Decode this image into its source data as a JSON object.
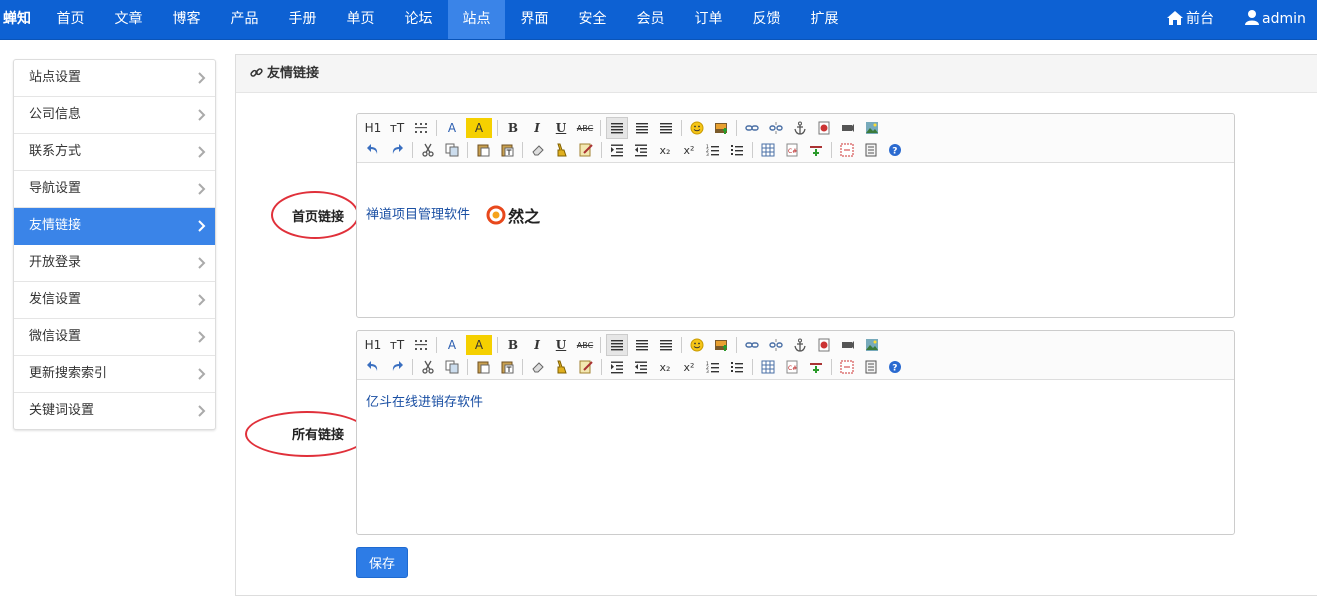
{
  "brand": "蝉知",
  "nav": {
    "items": [
      "首页",
      "文章",
      "博客",
      "产品",
      "手册",
      "单页",
      "论坛",
      "站点",
      "界面",
      "安全",
      "会员",
      "订单",
      "反馈",
      "扩展"
    ],
    "active": "站点",
    "frontend": "前台",
    "user": "admin"
  },
  "sidebar": {
    "items": [
      "站点设置",
      "公司信息",
      "联系方式",
      "导航设置",
      "友情链接",
      "开放登录",
      "发信设置",
      "微信设置",
      "更新搜索索引",
      "关键词设置"
    ],
    "active": "友情链接"
  },
  "panel": {
    "title": "友情链接"
  },
  "form": {
    "home_links_label": "首页链接",
    "all_links_label": "所有链接",
    "home_links_text": "禅道项目管理软件",
    "home_links_logo_text": "然之",
    "all_links_text": "亿斗在线进销存软件",
    "save_label": "保存"
  },
  "toolbar": {
    "heading_label": "H1",
    "fontsize_label": "тT",
    "bold": "B",
    "italic": "I",
    "underline": "U",
    "strike": "ABC",
    "font_color": "A",
    "bg_color": "A",
    "subscript": "x₂",
    "superscript": "x²"
  },
  "colors": {
    "nav_bg": "#0d61d3",
    "nav_active": "#3a84e8",
    "sidebar_active": "#3a84e8",
    "annotation": "#e0303a",
    "link_text": "#1a4fa3",
    "save_button": "#2d7ce6"
  }
}
